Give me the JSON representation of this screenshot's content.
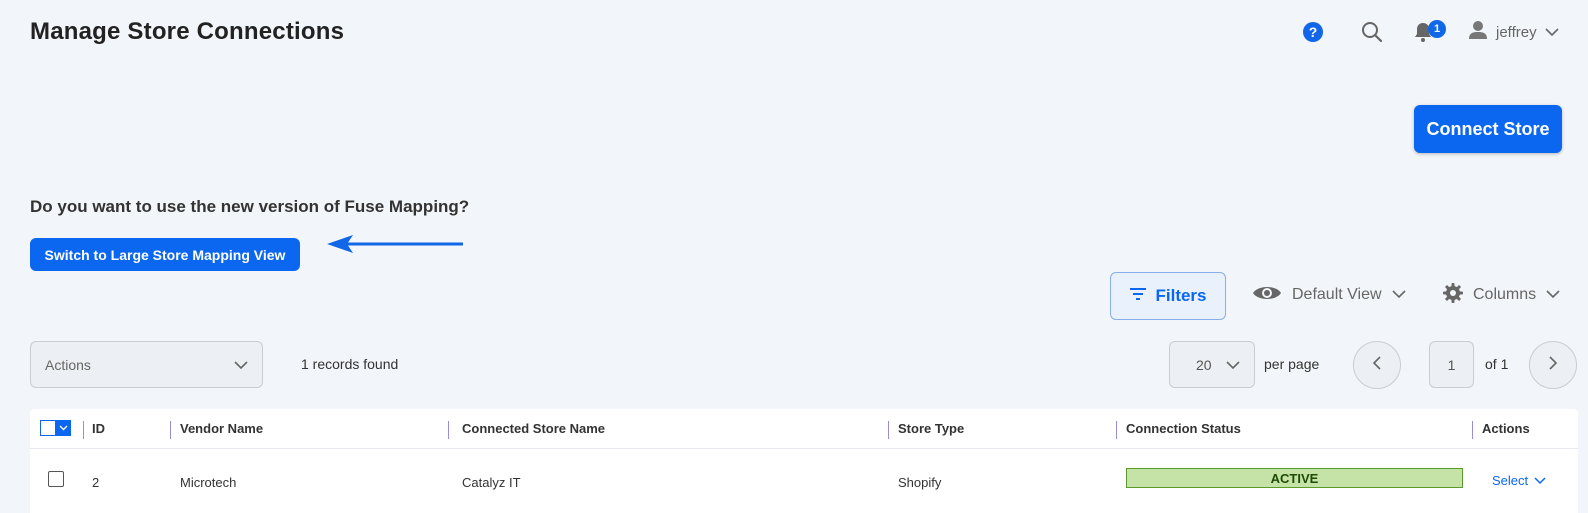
{
  "header": {
    "title": "Manage Store Connections",
    "notification_count": "1",
    "username": "jeffrey",
    "help_label": "?"
  },
  "connect_store_label": "Connect Store",
  "prompt": {
    "question": "Do you want to use the new version of Fuse Mapping?",
    "switch_label": "Switch to Large Store Mapping View"
  },
  "toolbar": {
    "filters_label": "Filters",
    "view_label": "Default View",
    "columns_label": "Columns"
  },
  "list_controls": {
    "actions_placeholder": "Actions",
    "records_found": "1 records found",
    "per_page_value": "20",
    "per_page_label": "per page",
    "page_value": "1",
    "page_of": "of 1"
  },
  "table": {
    "columns": [
      "ID",
      "Vendor Name",
      "Connected Store Name",
      "Store Type",
      "Connection Status",
      "Actions"
    ],
    "rows": [
      {
        "id": "2",
        "vendor": "Microtech",
        "store_name": "Catalyz IT",
        "store_type": "Shopify",
        "status": "ACTIVE",
        "action": "Select"
      }
    ]
  },
  "colors": {
    "primary": "#0b67f0",
    "background": "#f2f5f9",
    "status_active_bg": "#c5e3a6",
    "status_active_border": "#5d9a2c"
  },
  "icons": [
    "help-icon",
    "search-icon",
    "bell-icon",
    "user-icon",
    "chevron-down-icon",
    "arrow-left-icon",
    "filter-icon",
    "eye-icon",
    "gear-icon",
    "chevron-left-icon",
    "chevron-right-icon"
  ]
}
